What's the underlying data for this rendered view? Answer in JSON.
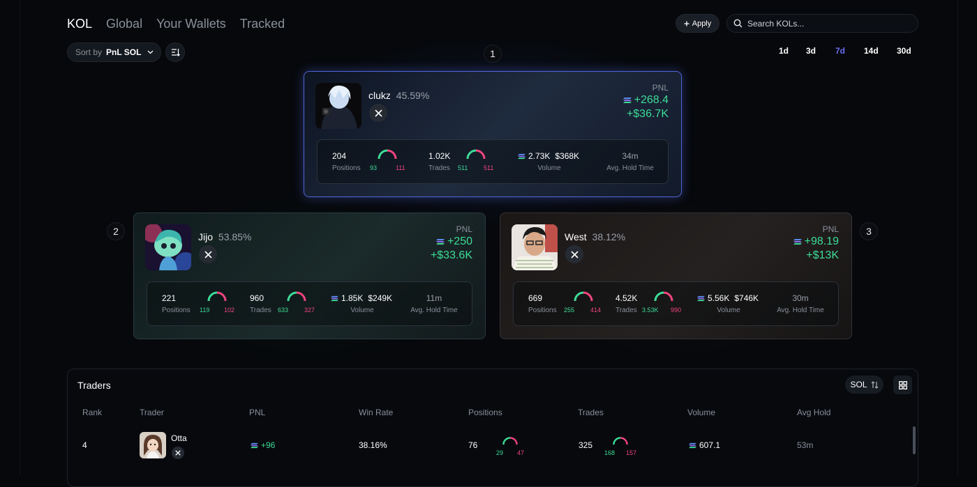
{
  "nav": {
    "tabs": [
      "KOL",
      "Global",
      "Your Wallets",
      "Tracked"
    ],
    "active": "KOL"
  },
  "header": {
    "apply_label": "Apply",
    "search_placeholder": "Search KOLs..."
  },
  "sort": {
    "label": "Sort by",
    "value": "PnL SOL"
  },
  "periods": {
    "items": [
      "1d",
      "3d",
      "7d",
      "14d",
      "30d"
    ],
    "active": "7d"
  },
  "podium": [
    {
      "rank": "1",
      "name": "clukz",
      "win_rate": "45.59%",
      "pnl_label": "PNL",
      "pnl_sol": "+268.4",
      "pnl_usd": "+$36.7K",
      "positions": "204",
      "positions_label": "Positions",
      "positions_win": "93",
      "positions_loss": "111",
      "trades": "1.02K",
      "trades_label": "Trades",
      "trades_buy": "511",
      "trades_sell": "511",
      "volume_sol": "2.73K",
      "volume_usd": "$368K",
      "volume_label": "Volume",
      "hold": "34m",
      "hold_label": "Avg. Hold Time"
    },
    {
      "rank": "2",
      "name": "Jijo",
      "win_rate": "53.85%",
      "pnl_label": "PNL",
      "pnl_sol": "+250",
      "pnl_usd": "+$33.6K",
      "positions": "221",
      "positions_label": "Positions",
      "positions_win": "119",
      "positions_loss": "102",
      "trades": "960",
      "trades_label": "Trades",
      "trades_buy": "633",
      "trades_sell": "327",
      "volume_sol": "1.85K",
      "volume_usd": "$249K",
      "volume_label": "Volume",
      "hold": "11m",
      "hold_label": "Avg. Hold Time"
    },
    {
      "rank": "3",
      "name": "West",
      "win_rate": "38.12%",
      "pnl_label": "PNL",
      "pnl_sol": "+98.19",
      "pnl_usd": "+$13K",
      "positions": "669",
      "positions_label": "Positions",
      "positions_win": "255",
      "positions_loss": "414",
      "trades": "4.52K",
      "trades_label": "Trades",
      "trades_buy": "3.53K",
      "trades_sell": "990",
      "volume_sol": "5.56K",
      "volume_usd": "$746K",
      "volume_label": "Volume",
      "hold": "30m",
      "hold_label": "Avg. Hold Time"
    }
  ],
  "traders": {
    "title": "Traders",
    "currency": "SOL",
    "columns": [
      "Rank",
      "Trader",
      "PNL",
      "Win Rate",
      "Positions",
      "Trades",
      "Volume",
      "Avg Hold"
    ],
    "rows": [
      {
        "rank": "4",
        "name": "Otta",
        "pnl": "+96",
        "win_rate": "38.16%",
        "positions": "76",
        "positions_win": "29",
        "positions_loss": "47",
        "trades": "325",
        "trades_buy": "168",
        "trades_sell": "157",
        "volume": "607.1",
        "hold": "53m"
      }
    ]
  },
  "colors": {
    "accent": "#6b6ff5",
    "gain": "#3ddc97",
    "loss": "#f0457e",
    "card1_border": "#5066d8"
  },
  "icons": [
    "plus-icon",
    "search-icon",
    "chevron-down-icon",
    "sort-direction-icon",
    "x-logo-icon",
    "solana-icon",
    "swap-arrows-icon",
    "grid-icon"
  ]
}
